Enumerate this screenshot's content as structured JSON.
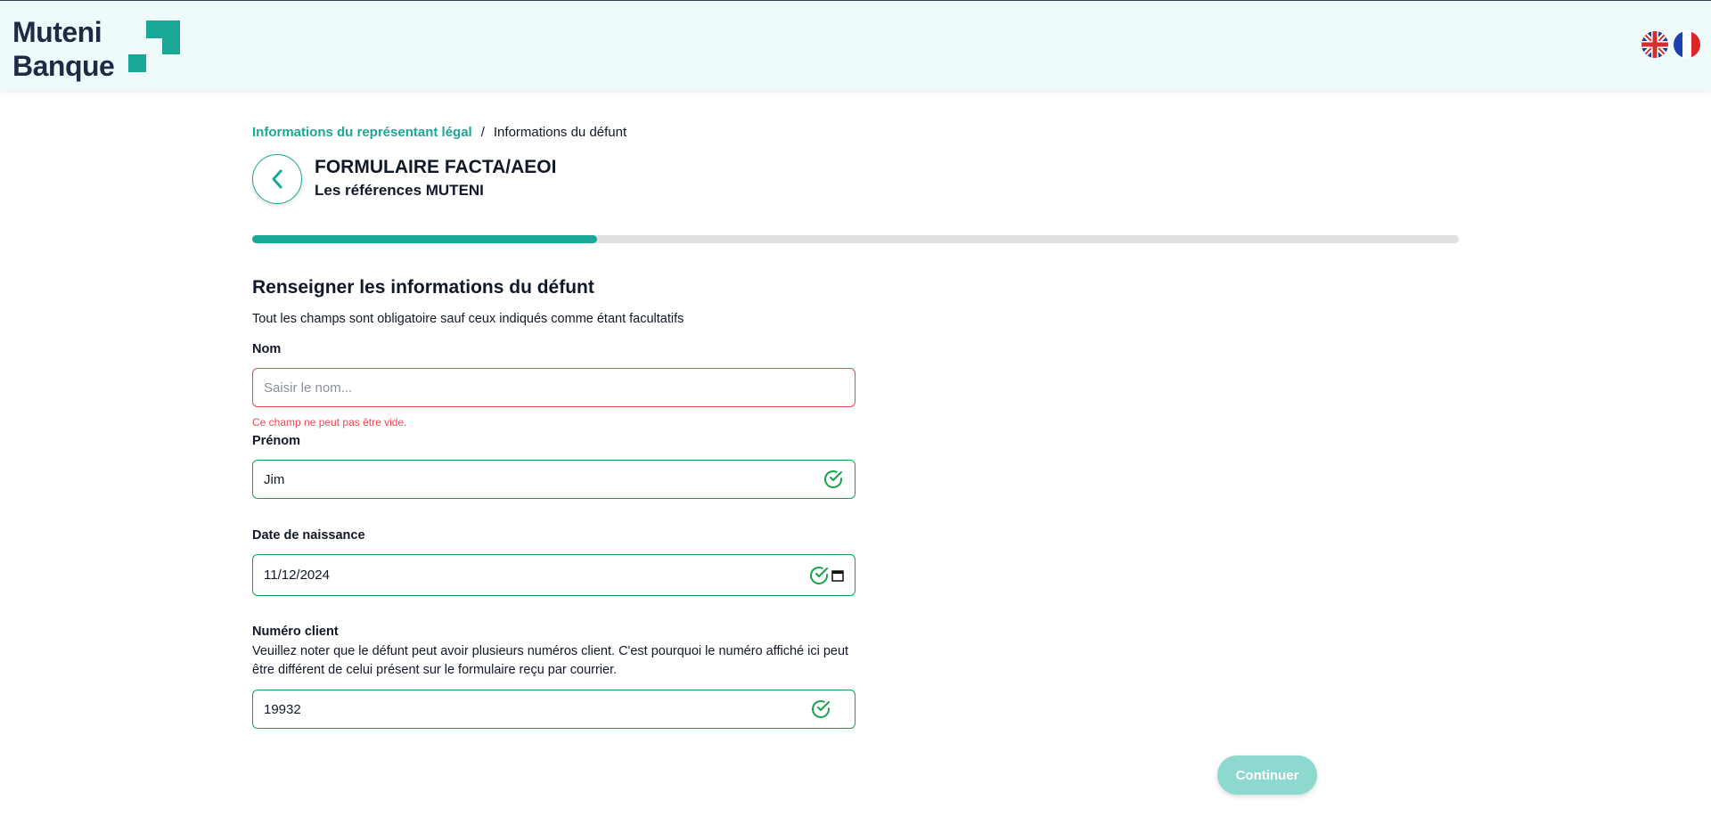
{
  "header": {
    "logo_line1": "Muteni",
    "logo_line2": "Banque",
    "languages": [
      "english-flag-icon",
      "french-flag-icon"
    ]
  },
  "breadcrumb": {
    "previous": "Informations du représentant légal",
    "separator": "/",
    "current": "Informations du défunt"
  },
  "page": {
    "title": "FORMULAIRE FACTA/AEOI",
    "subtitle": "Les références MUTENI",
    "progress_fraction": 0.286
  },
  "form": {
    "section_title": "Renseigner les informations du défunt",
    "hint": "Tout les champs sont obligatoire sauf ceux indiqués comme étant facultatifs",
    "nom": {
      "label": "Nom",
      "value": "",
      "placeholder": "Saisir le nom...",
      "error": "Ce champ ne peut pas être vide."
    },
    "prenom": {
      "label": "Prénom",
      "value": "Jim"
    },
    "date_naissance": {
      "label": "Date de naissance",
      "value": "11/12/2024"
    },
    "numero_client": {
      "label": "Numéro client",
      "note": "Veuillez noter que le défunt peut avoir plusieurs numéros client. C'est pourquoi le numéro affiché ici peut être différent de celui présent sur le formulaire reçu par courrier.",
      "value": "19932"
    },
    "continue_label": "Continuer"
  },
  "colors": {
    "accent": "#1aa896",
    "error": "#e5484d",
    "success": "#17a34a",
    "header_bg": "#effbfa",
    "button_disabled": "#8dd8cf"
  }
}
